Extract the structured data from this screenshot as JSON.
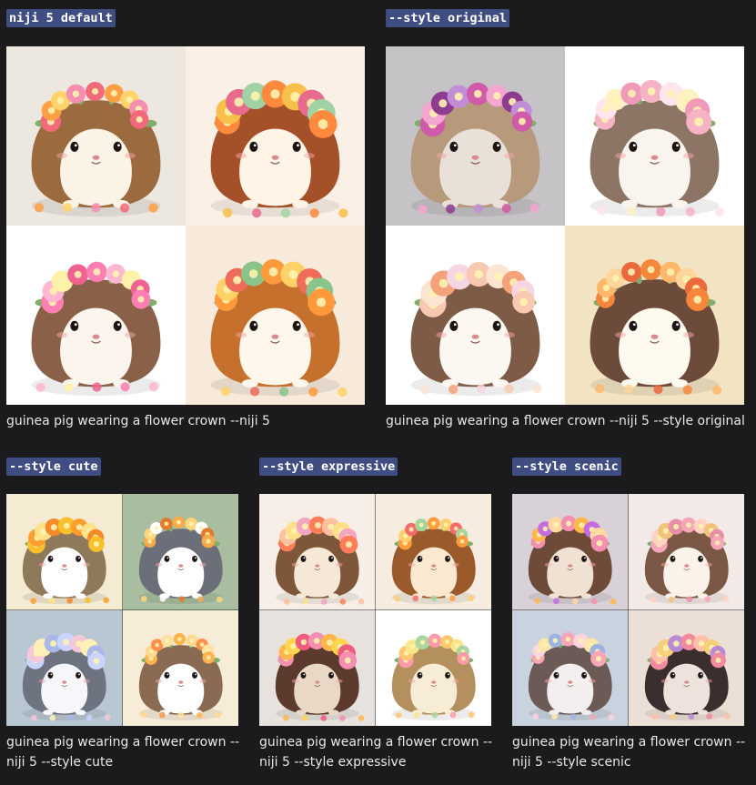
{
  "panels": [
    {
      "tag": "niji 5 default",
      "caption": "guinea pig wearing a flower crown --niji 5",
      "caption_lines": [
        "guinea pig wearing a flower crown --niji 5"
      ],
      "tiles": [
        {
          "bg": "#ece7df",
          "fur": "#9b6a3f",
          "belly": "#fbf3e6",
          "flowers": [
            "#f26a7a",
            "#ff9f43",
            "#ffd36b",
            "#f48fb1"
          ]
        },
        {
          "bg": "#fbf0e6",
          "fur": "#a4512a",
          "belly": "#fff4e6",
          "flowers": [
            "#ff8a3d",
            "#f7c04a",
            "#e86a8c",
            "#9fd3a6"
          ]
        },
        {
          "bg": "#ffffff",
          "fur": "#8a6148",
          "belly": "#fbf5ee",
          "flowers": [
            "#ff7eb3",
            "#ffb6d0",
            "#fff2a8",
            "#f06292"
          ]
        },
        {
          "bg": "#f7eadb",
          "fur": "#c5712d",
          "belly": "#fff6ec",
          "flowers": [
            "#ff9a3c",
            "#ffd166",
            "#ef6b5a",
            "#8bc48a"
          ]
        }
      ]
    },
    {
      "tag": "--style original",
      "caption": "guinea pig wearing a flower crown --niji 5 --style original",
      "caption_lines": [
        "guinea pig wearing a flower crown --niji 5 --style original"
      ],
      "tiles": [
        {
          "bg": "#c6c3c6",
          "fur": "#b79a7c",
          "belly": "#e9e1d8",
          "flowers": [
            "#d05ba8",
            "#f3a6cf",
            "#8e3c8f",
            "#c08dd6"
          ]
        },
        {
          "bg": "#ffffff",
          "fur": "#8c7565",
          "belly": "#faf4ee",
          "flowers": [
            "#f6b3c6",
            "#ffe4ec",
            "#fff2c2",
            "#f09ab8"
          ]
        },
        {
          "bg": "#ffffff",
          "fur": "#7d5b46",
          "belly": "#fdf7f2",
          "flowers": [
            "#f8c9b0",
            "#fbe4d2",
            "#f3a27a",
            "#f6d6e3"
          ]
        },
        {
          "bg": "#f2e4c3",
          "fur": "#6d4b3a",
          "belly": "#fffaf0",
          "flowers": [
            "#f5873c",
            "#ffb86b",
            "#ffd59a",
            "#ea6a3d"
          ]
        }
      ]
    },
    {
      "tag": "--style cute",
      "caption": "guinea pig wearing a flower crown -- niji 5 --style cute",
      "caption_lines": [
        "guinea pig wearing a flower crown --",
        "niji 5 --style cute"
      ],
      "tiles": [
        {
          "bg": "#f5ead2",
          "fur": "#8e7a5a",
          "belly": "#ffffff",
          "flowers": [
            "#f7c02b",
            "#ff9d2f",
            "#ffe38a",
            "#f58a2c"
          ]
        },
        {
          "bg": "#a9bea0",
          "fur": "#6a6f7a",
          "belly": "#ffffff",
          "flowers": [
            "#f8a94c",
            "#ffd77a",
            "#ffffff",
            "#e37a2e"
          ]
        },
        {
          "bg": "#b9c7d3",
          "fur": "#6d7480",
          "belly": "#f7f7fb",
          "flowers": [
            "#c9d4ff",
            "#f6c7d8",
            "#fff0b8",
            "#a9b8e8"
          ]
        },
        {
          "bg": "#f7ecd8",
          "fur": "#8a6a52",
          "belly": "#ffffff",
          "flowers": [
            "#ffb34d",
            "#ffd98f",
            "#ff8f4a",
            "#fce1a0"
          ]
        }
      ]
    },
    {
      "tag": "--style expressive",
      "caption": "guinea pig wearing a flower crown -- niji 5 --style expressive",
      "caption_lines": [
        "guinea pig wearing a flower crown --",
        "niji 5 --style expressive"
      ],
      "tiles": [
        {
          "bg": "#f7efe7",
          "fur": "#7e5639",
          "belly": "#f5e8d6",
          "flowers": [
            "#ff7e59",
            "#ffc0a0",
            "#ffe08a",
            "#f2a6c2"
          ]
        },
        {
          "bg": "#f6ecdf",
          "fur": "#9b5a2c",
          "belly": "#fae8d0",
          "flowers": [
            "#ff9d3d",
            "#ffcf6e",
            "#f46c6c",
            "#a7d49b"
          ]
        },
        {
          "bg": "#e7e2de",
          "fur": "#5c3a2d",
          "belly": "#e9d8c6",
          "flowers": [
            "#f48fb1",
            "#ffb74d",
            "#ffd54f",
            "#ef5b7d"
          ]
        },
        {
          "bg": "#ffffff",
          "fur": "#b3905d",
          "belly": "#f7ecd6",
          "flowers": [
            "#ff9aa8",
            "#ffc86e",
            "#f9e58a",
            "#a8d5a0"
          ]
        }
      ]
    },
    {
      "tag": "--style scenic",
      "caption": "guinea pig wearing a flower crown -- niji 5 --style scenic",
      "caption_lines": [
        "guinea pig wearing a flower crown --",
        "niji 5 --style scenic"
      ],
      "tiles": [
        {
          "bg": "#d8d1d8",
          "fur": "#6e4a38",
          "belly": "#efe2d2",
          "flowers": [
            "#f48fb1",
            "#ffb74d",
            "#c36be0",
            "#ffd9a0"
          ]
        },
        {
          "bg": "#f3e9e7",
          "fur": "#7a5845",
          "belly": "#fbf2ea",
          "flowers": [
            "#f7a6b8",
            "#ffd3c2",
            "#f0c27a",
            "#e78fa6"
          ]
        },
        {
          "bg": "#c9d3df",
          "fur": "#6b5a55",
          "belly": "#f2efee",
          "flowers": [
            "#f6a6b4",
            "#fbd5e0",
            "#ffe6a8",
            "#9db4e2"
          ]
        },
        {
          "bg": "#ecdfd6",
          "fur": "#3b2e2e",
          "belly": "#ede3dc",
          "flowers": [
            "#f08ba0",
            "#ffc0a8",
            "#f7d07a",
            "#b98bd6"
          ]
        }
      ]
    }
  ]
}
